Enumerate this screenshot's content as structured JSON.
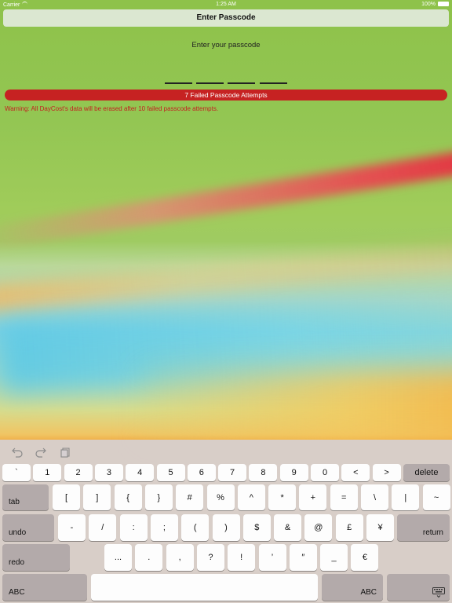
{
  "status_bar": {
    "carrier": "Carrier",
    "time": "1:25 AM",
    "battery": "100%"
  },
  "header": {
    "title": "Enter Passcode"
  },
  "passcode": {
    "prompt": "Enter your passcode",
    "failed_attempts": "7 Failed Passcode Attempts",
    "warning": "Warning: All DayCost's data will be erased after 10 failed passcode attempts."
  },
  "keyboard": {
    "row1": [
      "`",
      "1",
      "2",
      "3",
      "4",
      "5",
      "6",
      "7",
      "8",
      "9",
      "0",
      "<",
      ">"
    ],
    "delete": "delete",
    "tab": "tab",
    "row2": [
      "[",
      "]",
      "{",
      "}",
      "#",
      "%",
      "^",
      "*",
      "+",
      "=",
      "\\",
      "|",
      "~"
    ],
    "undo": "undo",
    "row3": [
      "-",
      "/",
      ":",
      ";",
      "(",
      ")",
      "$",
      "&",
      "@",
      "£",
      "¥"
    ],
    "return": "return",
    "redo": "redo",
    "row4": [
      "...",
      ".",
      ",",
      "?",
      "!",
      "’",
      "″",
      "_",
      "€"
    ],
    "abc_left": "ABC",
    "abc_right": "ABC",
    "icons": {
      "undo": "undo-arrow-icon",
      "redo": "redo-arrow-icon",
      "paste": "clipboard-icon",
      "dismiss": "keyboard-dismiss-icon"
    }
  },
  "colors": {
    "failed_bar": "#c62222",
    "warning_text": "#c32020",
    "header_bg": "#e6ece4"
  }
}
